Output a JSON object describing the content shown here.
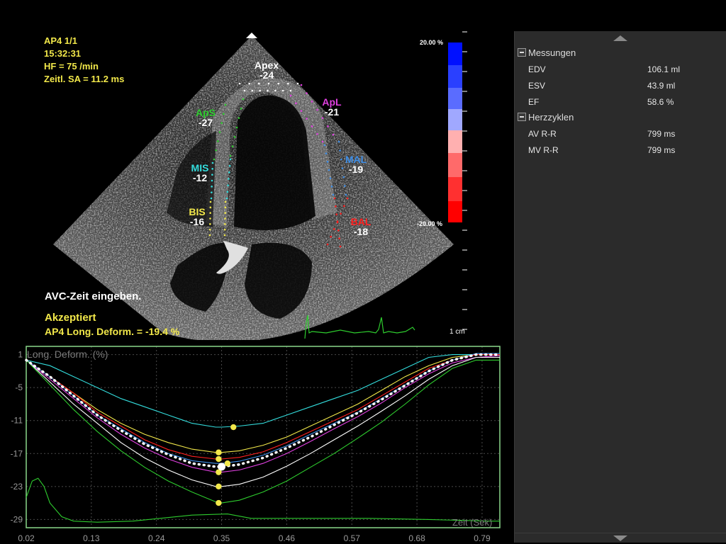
{
  "info": {
    "view": "AP4  1/1",
    "time": "15:32:31",
    "hr": "HF = 75 /min",
    "frame": "Zeitl. SA = 11.2 ms"
  },
  "messages": {
    "prompt": "AVC-Zeit eingeben.",
    "status": "Akzeptiert",
    "result": "AP4 Long. Deform. = -19.4 %"
  },
  "segments": [
    {
      "name": "Apex",
      "value": "-24",
      "color": "#ffffff"
    },
    {
      "name": "ApS",
      "value": "-27",
      "color": "#2ecc2e"
    },
    {
      "name": "ApL",
      "value": "-21",
      "color": "#e040e0"
    },
    {
      "name": "MIS",
      "value": "-12",
      "color": "#33dddd"
    },
    {
      "name": "MAL",
      "value": "-19",
      "color": "#3f8fe8"
    },
    {
      "name": "BIS",
      "value": "-16",
      "color": "#f2e84a"
    },
    {
      "name": "BAL",
      "value": "-18",
      "color": "#ff2020"
    }
  ],
  "color_scale": {
    "max": "20.00 %",
    "min": "-20.00 %"
  },
  "scale_bar": "1 cm",
  "chart_data": {
    "type": "line",
    "title": "Long. Deform. (%)",
    "xlabel": "Zeit (Sek)",
    "x_ticks": [
      "0.02",
      "0.13",
      "0.24",
      "0.35",
      "0.46",
      "0.57",
      "0.68",
      "0.79"
    ],
    "y_ticks": [
      "1",
      "-5",
      "-11",
      "-17",
      "-23",
      "-29"
    ],
    "xlim": [
      0.02,
      0.82
    ],
    "ylim": [
      -30.5,
      2.5
    ],
    "grid": true,
    "x": [
      0.02,
      0.06,
      0.1,
      0.14,
      0.18,
      0.22,
      0.26,
      0.3,
      0.34,
      0.35,
      0.38,
      0.42,
      0.46,
      0.5,
      0.54,
      0.58,
      0.62,
      0.66,
      0.7,
      0.74,
      0.78,
      0.82
    ],
    "series": [
      {
        "color": "#33dddd",
        "values": [
          0,
          -1,
          -3,
          -5,
          -7,
          -8.5,
          -10,
          -11.5,
          -12.2,
          -12.2,
          -12,
          -11.5,
          -10,
          -8.5,
          -7,
          -5.5,
          -3.5,
          -1.5,
          0.5,
          1,
          1,
          1
        ]
      },
      {
        "color": "#f2e84a",
        "values": [
          0,
          -3,
          -6,
          -9,
          -11.5,
          -13.5,
          -15,
          -16.2,
          -16.8,
          -16.8,
          -16.5,
          -15.5,
          -14,
          -12,
          -10,
          -8,
          -5.5,
          -3,
          -1,
          0.5,
          1,
          1
        ]
      },
      {
        "color": "#ff2020",
        "values": [
          0,
          -3,
          -6,
          -9.5,
          -12,
          -14.5,
          -16.3,
          -17.5,
          -18,
          -18,
          -17.7,
          -16.7,
          -15,
          -13,
          -11,
          -9,
          -6.5,
          -4,
          -1.5,
          0,
          1,
          1
        ]
      },
      {
        "color": "#3f8fe8",
        "values": [
          0,
          -3,
          -6.5,
          -10,
          -12.5,
          -15,
          -17,
          -18.3,
          -18.8,
          -18.8,
          -18.4,
          -17.3,
          -15.6,
          -13.5,
          -11.5,
          -9.5,
          -7,
          -4.5,
          -2,
          0,
          1.2,
          1.2
        ]
      },
      {
        "color": "#e040e0",
        "values": [
          0,
          -3.5,
          -7,
          -10.5,
          -13.5,
          -16,
          -18,
          -19.5,
          -20.4,
          -20.4,
          -20,
          -18.8,
          -17,
          -14.8,
          -12.5,
          -10.3,
          -7.8,
          -5,
          -2.5,
          -0.5,
          0.5,
          0.8
        ]
      },
      {
        "color": "#ffffff",
        "values": [
          0,
          -4,
          -8,
          -11.5,
          -15,
          -17.8,
          -20,
          -21.8,
          -23,
          -23,
          -22.6,
          -21.3,
          -19.3,
          -17,
          -14.5,
          -12,
          -9.3,
          -6.5,
          -3.5,
          -1,
          0.5,
          0.5
        ]
      },
      {
        "color": "#2ecc2e",
        "values": [
          0,
          -4.5,
          -9,
          -13,
          -16.5,
          -19.5,
          -22,
          -24,
          -25.8,
          -26,
          -25.5,
          -24,
          -22,
          -19.5,
          -17,
          -14.2,
          -11.3,
          -8,
          -4.5,
          -1.5,
          0,
          0
        ]
      }
    ],
    "average": {
      "color": "#ffffff",
      "values": [
        0,
        -3,
        -6.5,
        -10,
        -12.8,
        -15.3,
        -17.2,
        -18.8,
        -19.4,
        -19.4,
        -19,
        -17.8,
        -16,
        -14,
        -11.8,
        -9.6,
        -7.2,
        -4.6,
        -2,
        0,
        1,
        1
      ]
    },
    "ecg": {
      "color": "#2ecc2e",
      "x": [
        0.02,
        0.03,
        0.04,
        0.05,
        0.06,
        0.08,
        0.1,
        0.14,
        0.2,
        0.3,
        0.36,
        0.4,
        0.5,
        0.6,
        0.7,
        0.8,
        0.82
      ],
      "values": [
        -25,
        -22,
        -21.5,
        -23,
        -26,
        -28.5,
        -29.3,
        -29.5,
        -29.3,
        -28.2,
        -28,
        -28.8,
        -28.8,
        -28.8,
        -29.0,
        -29.3,
        -29.3
      ]
    },
    "peak_markers": {
      "x": 0.35,
      "values": [
        -12.2,
        -16.8,
        -18,
        -18.8,
        -20.4,
        -23,
        -26,
        -19.4
      ]
    }
  },
  "panel": {
    "sections": [
      {
        "title": "Messungen",
        "rows": [
          {
            "label": "EDV",
            "value": "106.1 ml"
          },
          {
            "label": "ESV",
            "value": "43.9 ml"
          },
          {
            "label": "EF",
            "value": "58.6 %"
          }
        ]
      },
      {
        "title": "Herzzyklen",
        "rows": [
          {
            "label": "AV R-R",
            "value": "799 ms"
          },
          {
            "label": "MV R-R",
            "value": "799 ms"
          }
        ]
      }
    ]
  }
}
